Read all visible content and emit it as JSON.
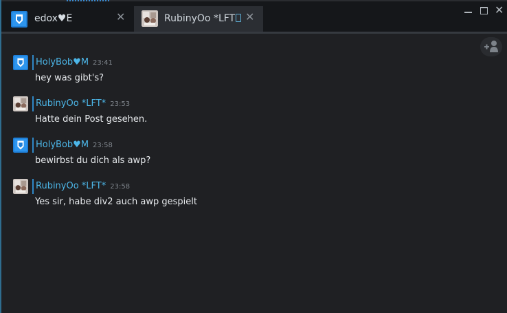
{
  "tabs": [
    {
      "label": "edox♥E",
      "close": "✕",
      "avatar": "holybob-avatar"
    },
    {
      "label": "RubinyOo *LFT",
      "close": "✕",
      "avatar": "rubinyoo-avatar"
    }
  ],
  "window_controls": {
    "minimize": "",
    "maximize": "",
    "close": "✕"
  },
  "messages": [
    {
      "author": "HolyBob♥M",
      "time": "23:41",
      "text": "hey was gibt's?",
      "avatar": "holybob-avatar"
    },
    {
      "author": "RubinyOo *LFT*",
      "time": "23:53",
      "text": "Hatte dein Post gesehen.",
      "avatar": "rubinyoo-avatar"
    },
    {
      "author": "HolyBob♥M",
      "time": "23:58",
      "text": "bewirbst du dich als awp?",
      "avatar": "holybob-avatar"
    },
    {
      "author": "RubinyOo *LFT*",
      "time": "23:58",
      "text": "Yes sir, habe div2 auch awp gespielt",
      "avatar": "rubinyoo-avatar"
    }
  ],
  "colors": {
    "accent": "#4cb6e8",
    "background": "#1f2023",
    "tabbar": "#15171a"
  }
}
